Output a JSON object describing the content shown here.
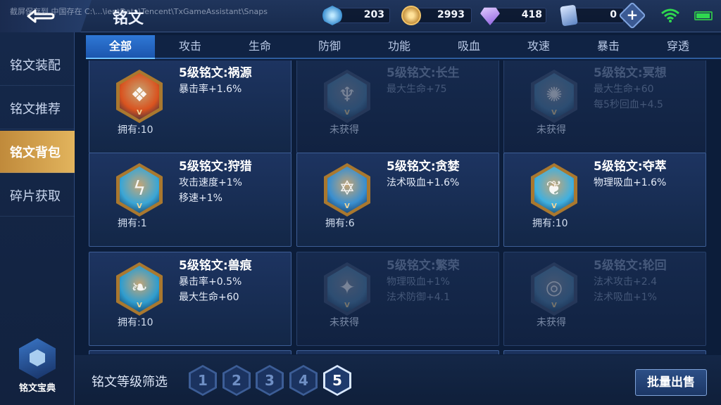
{
  "header": {
    "path_text": "截屏保存到 中国存在 C:\\...\\ientData\\Tencent\\TxGameAssistant\\Snaps",
    "title": "铭文",
    "resources": [
      {
        "icon": "blue-crystal-icon",
        "value": "203",
        "color": "#5fb6ea"
      },
      {
        "icon": "gold-coin-icon",
        "value": "2993",
        "color": "#d9a441"
      },
      {
        "icon": "purple-diamond-icon",
        "value": "418",
        "color": "#b58cf2"
      },
      {
        "icon": "inscription-card-icon",
        "value": "0",
        "color": "#8fb4e6"
      }
    ],
    "plus_label": "+"
  },
  "sidebar": {
    "items": [
      {
        "label": "铭文装配",
        "active": false
      },
      {
        "label": "铭文推荐",
        "active": false
      },
      {
        "label": "铭文背包",
        "active": true
      },
      {
        "label": "碎片获取",
        "active": false
      }
    ],
    "codex_label": "铭文宝典"
  },
  "tabs": [
    "全部",
    "攻击",
    "生命",
    "防御",
    "功能",
    "吸血",
    "攻速",
    "暴击",
    "穿透"
  ],
  "cards": [
    {
      "name": "5级铭文:祸源",
      "stats": [
        "暴击率+1.6%"
      ],
      "own": "拥有:10",
      "locked": false,
      "color": "#d9531f",
      "symbol": "❖"
    },
    {
      "name": "5级铭文:长生",
      "stats": [
        "最大生命+75"
      ],
      "own": "未获得",
      "locked": true,
      "color": "#4c7ea6",
      "symbol": "♆"
    },
    {
      "name": "5级铭文:冥想",
      "stats": [
        "最大生命+60",
        "每5秒回血+4.5"
      ],
      "own": "未获得",
      "locked": true,
      "color": "#4c7ea6",
      "symbol": "✺"
    },
    {
      "name": "5级铭文:狩猎",
      "stats": [
        "攻击速度+1%",
        "移速+1%"
      ],
      "own": "拥有:1",
      "locked": false,
      "color": "#3aa6d6",
      "symbol": "ϟ"
    },
    {
      "name": "5级铭文:贪婪",
      "stats": [
        "法术吸血+1.6%"
      ],
      "own": "拥有:6",
      "locked": false,
      "color": "#3a8fcf",
      "symbol": "✡"
    },
    {
      "name": "5级铭文:夺萃",
      "stats": [
        "物理吸血+1.6%"
      ],
      "own": "拥有:10",
      "locked": false,
      "color": "#3fb0e0",
      "symbol": "❦"
    },
    {
      "name": "5级铭文:兽痕",
      "stats": [
        "暴击率+0.5%",
        "最大生命+60"
      ],
      "own": "拥有:10",
      "locked": false,
      "color": "#2f9dcf",
      "symbol": "❧"
    },
    {
      "name": "5级铭文:繁荣",
      "stats": [
        "物理吸血+1%",
        "法术防御+4.1"
      ],
      "own": "未获得",
      "locked": true,
      "color": "#4c7ea6",
      "symbol": "✦"
    },
    {
      "name": "5级铭文:轮回",
      "stats": [
        "法术攻击+2.4",
        "法术吸血+1%"
      ],
      "own": "未获得",
      "locked": true,
      "color": "#4c7ea6",
      "symbol": "◎"
    }
  ],
  "level_suffix": "V",
  "bottom": {
    "filter_label": "铭文等级筛选",
    "levels": [
      "1",
      "2",
      "3",
      "4",
      "5"
    ],
    "active_level": "5",
    "sell_label": "批量出售"
  }
}
